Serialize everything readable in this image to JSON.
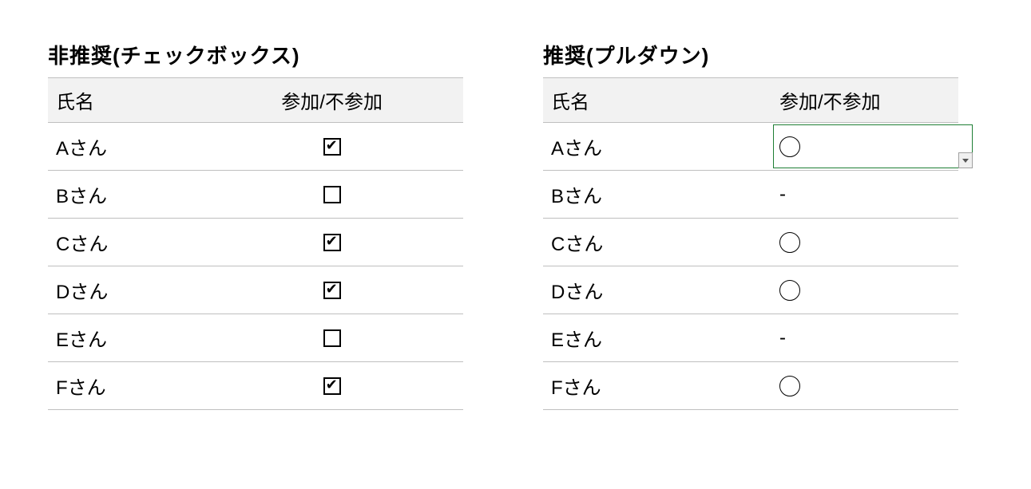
{
  "left": {
    "title": "非推奨(チェックボックス)",
    "headers": {
      "name": "氏名",
      "status": "参加/不参加"
    },
    "rows": [
      {
        "name": "Aさん",
        "checked": true
      },
      {
        "name": "Bさん",
        "checked": false
      },
      {
        "name": "Cさん",
        "checked": true
      },
      {
        "name": "Dさん",
        "checked": true
      },
      {
        "name": "Eさん",
        "checked": false
      },
      {
        "name": "Fさん",
        "checked": true
      }
    ]
  },
  "right": {
    "title": "推奨(プルダウン)",
    "headers": {
      "name": "氏名",
      "status": "参加/不参加"
    },
    "rows": [
      {
        "name": "Aさん",
        "value": "○",
        "selected": true
      },
      {
        "name": "Bさん",
        "value": "-"
      },
      {
        "name": "Cさん",
        "value": "○"
      },
      {
        "name": "Dさん",
        "value": "○"
      },
      {
        "name": "Eさん",
        "value": "-"
      },
      {
        "name": "Fさん",
        "value": "○"
      }
    ]
  }
}
